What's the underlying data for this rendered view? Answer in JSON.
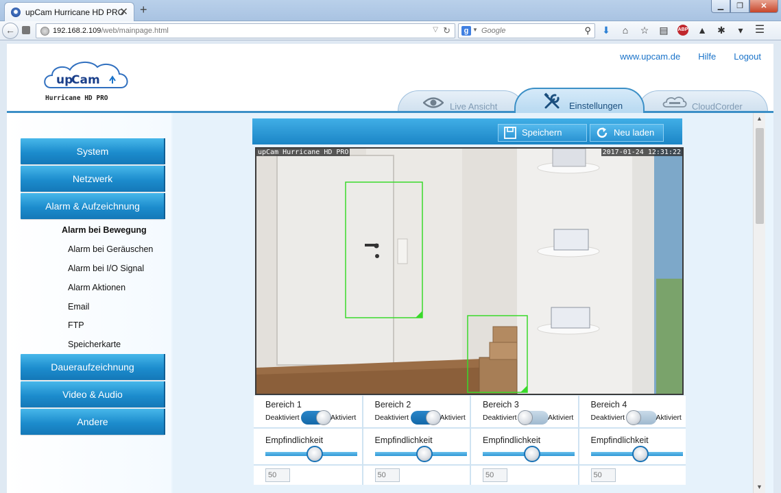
{
  "browser": {
    "tab_title": "upCam Hurricane HD PRO",
    "tab_close": "✕",
    "new_tab": "+",
    "url_host": "192.168.2.109",
    "url_path": "/web/mainpage.html",
    "search_placeholder": "Google",
    "window_buttons": [
      "▁",
      "❐",
      "✕"
    ]
  },
  "header": {
    "logo_brand": "upCam",
    "logo_model": "Hurricane HD PRO",
    "links": [
      "www.upcam.de",
      "Hilfe",
      "Logout"
    ],
    "tabs": [
      {
        "label": "Live Ansicht",
        "icon": "eye-icon"
      },
      {
        "label": "Einstellungen",
        "icon": "tools-icon",
        "active": true
      },
      {
        "label": "CloudCorder",
        "icon": "cloud-icon"
      }
    ]
  },
  "sidebar": {
    "main_items": [
      "System",
      "Netzwerk",
      "Alarm & Aufzeichnung",
      "Daueraufzeichnung",
      "Video & Audio",
      "Andere"
    ],
    "sub_items": [
      "Alarm bei Bewegung",
      "Alarm bei Geräuschen",
      "Alarm bei I/O Signal",
      "Alarm Aktionen",
      "Email",
      "FTP",
      "Speicherkarte"
    ],
    "active_sub": "Alarm bei Bewegung"
  },
  "actions": {
    "save": "Speichern",
    "reload": "Neu laden"
  },
  "video": {
    "osd_left": "upCam Hurricane HD PRO",
    "osd_right": "2017-01-24 12:31:22"
  },
  "zones": [
    {
      "name": "Bereich 1",
      "deact": "Deaktiviert",
      "act": "Aktiviert",
      "enabled": true,
      "sens_label": "Empfindlichkeit",
      "value": "50"
    },
    {
      "name": "Bereich 2",
      "deact": "Deaktiviert",
      "act": "Aktiviert",
      "enabled": true,
      "sens_label": "Empfindlichkeit",
      "value": "50"
    },
    {
      "name": "Bereich 3",
      "deact": "Deaktiviert",
      "act": "Aktiviert",
      "enabled": false,
      "sens_label": "Empfindlichkeit",
      "value": "50"
    },
    {
      "name": "Bereich 4",
      "deact": "Deaktiviert",
      "act": "Aktiviert",
      "enabled": false,
      "sens_label": "Empfindlichkeit",
      "value": "50"
    }
  ],
  "colors": {
    "accent": "#1c8ccd",
    "motion_box": "#39d92a"
  }
}
